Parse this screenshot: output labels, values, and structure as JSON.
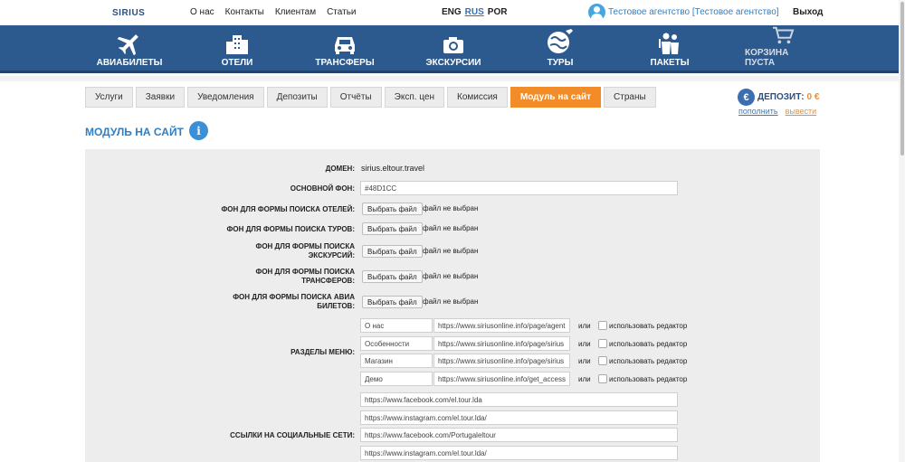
{
  "header": {
    "logo": "SIRIUS",
    "nav": [
      "О нас",
      "Контакты",
      "Клиентам",
      "Статьи"
    ],
    "langs": [
      "ENG",
      "RUS",
      "POR"
    ],
    "active_lang": "RUS",
    "agency": "Тестовое агентство [Тестовое агентство]",
    "logout": "Выход"
  },
  "mainnav": [
    {
      "label": "АВИАБИЛЕТЫ",
      "icon": "plane-icon"
    },
    {
      "label": "ОТЕЛИ",
      "icon": "hotel-icon"
    },
    {
      "label": "ТРАНСФЕРЫ",
      "icon": "car-icon"
    },
    {
      "label": "ЭКСКУРСИИ",
      "icon": "camera-icon"
    },
    {
      "label": "ТУРЫ",
      "icon": "globe-icon"
    },
    {
      "label": "ПАКЕТЫ",
      "icon": "people-icon"
    },
    {
      "label": "КОРЗИНА ПУСТА",
      "icon": "cart-icon"
    }
  ],
  "tabs": [
    "Услуги",
    "Заявки",
    "Уведомления",
    "Депозиты",
    "Отчёты",
    "Эксп. цен",
    "Комиссия",
    "Модуль на сайт",
    "Страны"
  ],
  "active_tab": "Модуль на сайт",
  "deposit": {
    "label": "ДЕПОЗИТ:",
    "amount": "0 €",
    "topup": "пополнить",
    "withdraw": "вывести",
    "currency_symbol": "€"
  },
  "page_title": "МОДУЛЬ НА САЙТ",
  "info_symbol": "i",
  "form": {
    "domain_label": "ДОМЕН:",
    "domain_value": "sirius.eltour.travel",
    "bg_label": "ОСНОВНОЙ ФОН:",
    "bg_value": "#48D1CC",
    "file_rows": [
      {
        "label": "ФОН ДЛЯ ФОРМЫ ПОИСКА ОТЕЛЕЙ:"
      },
      {
        "label": "ФОН ДЛЯ ФОРМЫ ПОИСКА ТУРОВ:"
      },
      {
        "label": "ФОН ДЛЯ ФОРМЫ ПОИСКА ЭКСКУРСИЙ:"
      },
      {
        "label": "ФОН ДЛЯ ФОРМЫ ПОИСКА ТРАНСФЕРОВ:"
      },
      {
        "label": "ФОН ДЛЯ ФОРМЫ ПОИСКА АВИА БИЛЕТОВ:"
      }
    ],
    "file_button": "Выбрать файл",
    "no_file": "файл не выбран",
    "menu_label": "РАЗДЕЛЫ МЕНЮ:",
    "menu_rows": [
      {
        "name": "О нас",
        "url": "https://www.siriusonline.info/page/agent"
      },
      {
        "name": "Особенности",
        "url": "https://www.siriusonline.info/page/sirius"
      },
      {
        "name": "Магазин",
        "url": "https://www.siriusonline.info/page/sirius"
      },
      {
        "name": "Демо",
        "url": "https://www.siriusonline.info/get_access"
      }
    ],
    "or_text": "или",
    "use_editor": "использовать редактор",
    "social_label": "ССЫЛКИ НА СОЦИАЛЬНЫЕ СЕТИ:",
    "social_links": [
      "https://www.facebook.com/el.tour.lda",
      "https://www.instagram.com/el.tour.lda/",
      "https://www.facebook.com/Portugaleltour",
      "https://www.instagram.com/el.tour.lda/"
    ]
  },
  "colors": {
    "brand_blue": "#2d5a8e",
    "accent_orange": "#f28c28",
    "link_blue": "#2f7fc4"
  }
}
